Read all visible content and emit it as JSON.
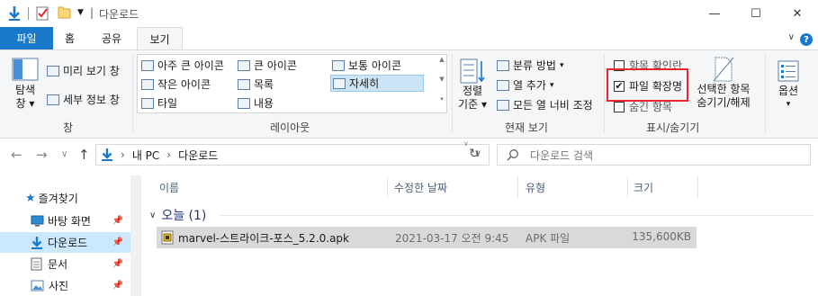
{
  "window": {
    "title": "다운로드",
    "separator": "|",
    "minimize": "—",
    "maximize": "☐",
    "close": "✕"
  },
  "tabs": {
    "file": "파일",
    "home": "홈",
    "share": "공유",
    "view": "보기"
  },
  "ribbon": {
    "pane": {
      "nav_pane_line1": "탐색",
      "nav_pane_line2": "창",
      "preview": "미리 보기 창",
      "details": "세부 정보 창",
      "group_label": "창"
    },
    "layout": {
      "items": [
        "아주 큰 아이콘",
        "큰 아이콘",
        "보통 아이콘",
        "작은 아이콘",
        "목록",
        "자세히",
        "타일",
        "내용"
      ],
      "group_label": "레이아웃"
    },
    "current_view": {
      "sort_line1": "정렬",
      "sort_line2": "기준",
      "group_by": "분류 방법",
      "add_columns": "열 추가",
      "size_all": "모든 열 너비 조정",
      "group_label": "현재 보기"
    },
    "show_hide": {
      "item_checkboxes": "항목 확인란",
      "file_extensions": "파일 확장명",
      "hidden_items": "숨긴 항목",
      "hide_selected_line1": "선택한 항목",
      "hide_selected_line2": "숨기기/해제",
      "group_label": "표시/숨기기",
      "item_checkboxes_checked": false,
      "file_extensions_checked": true,
      "hidden_items_checked": false
    },
    "options": {
      "label": "옵션"
    }
  },
  "address": {
    "crumbs": [
      "내 PC",
      "다운로드"
    ],
    "crumb_sep": "›",
    "search_placeholder": "다운로드 검색"
  },
  "nav": {
    "quick_access": "즐겨찾기",
    "items": [
      "바탕 화면",
      "다운로드",
      "문서",
      "사진"
    ]
  },
  "columns": {
    "name": "이름",
    "date": "수정한 날짜",
    "type": "유형",
    "size": "크기"
  },
  "group": {
    "label": "오늘 (1)"
  },
  "files": [
    {
      "name": "marvel-스트라이크-포스_5.2.0.apk",
      "date": "2021-03-17 오전 9:45",
      "type": "APK 파일",
      "size": "135,600KB"
    }
  ],
  "colors": {
    "accent": "#1979ca",
    "highlight": "#e8262c",
    "selection": "#cce8ff"
  }
}
